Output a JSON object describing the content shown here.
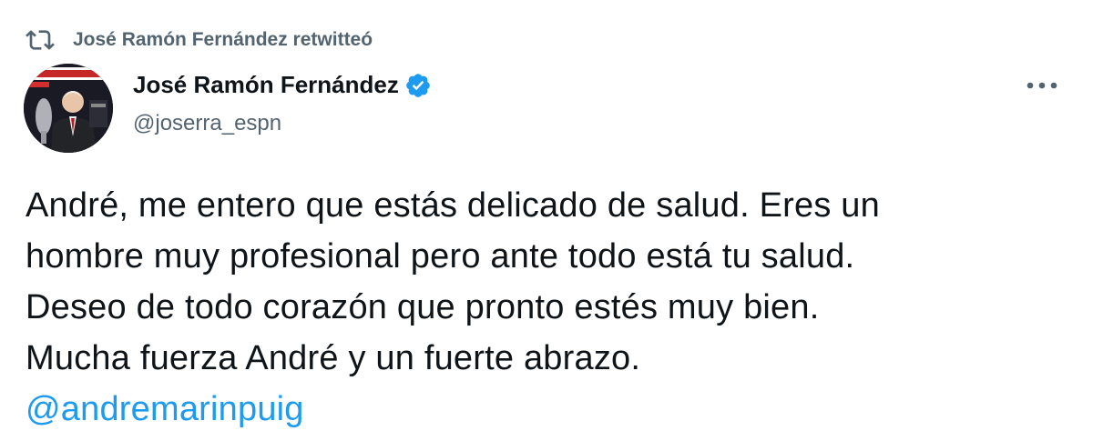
{
  "retweet": {
    "icon": "retweet-icon",
    "text": "José Ramón Fernández retwitteó"
  },
  "author": {
    "display_name": "José Ramón Fernández",
    "handle": "@joserra_espn",
    "verified_icon": "verified-badge-icon",
    "verified_color": "#1d9bf0",
    "avatar_icon": "avatar"
  },
  "more_button": {
    "icon": "more-horizontal-icon"
  },
  "tweet": {
    "lines": [
      "André, me entero que estás delicado de salud. Eres un",
      "hombre muy profesional pero ante todo está tu salud.",
      "Deseo de todo corazón que pronto estés muy bien.",
      "Mucha fuerza André y un fuerte abrazo."
    ],
    "mention": "@andremarinpuig",
    "mention_color": "#1d9bf0"
  }
}
